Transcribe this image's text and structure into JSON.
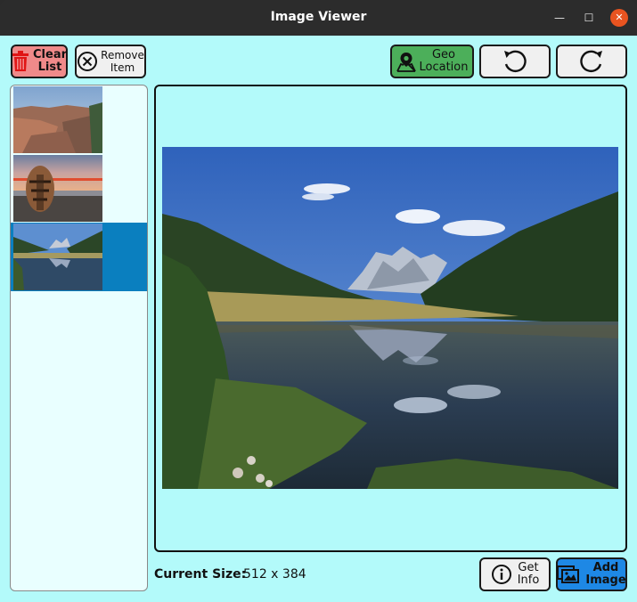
{
  "window": {
    "title": "Image Viewer",
    "minimize_glyph": "—",
    "maximize_glyph": "☐",
    "close_glyph": "✕"
  },
  "toolbar": {
    "clear_label_1": "Clear",
    "clear_label_2": "List",
    "remove_label_1": "Remove",
    "remove_label_2": "Item",
    "geo_label_1": "Geo",
    "geo_label_2": "Location",
    "icons": [
      "trash-icon",
      "circle-x-icon",
      "map-pin-icon",
      "rotate-left-icon",
      "rotate-right-icon"
    ]
  },
  "sidebar": {
    "items": [
      {
        "name": "canyon",
        "selected": false
      },
      {
        "name": "beach-sunset-carving",
        "selected": false
      },
      {
        "name": "mountain-lake",
        "selected": true
      }
    ]
  },
  "status": {
    "size_label": "Current Size:",
    "size_value": "512 x 384"
  },
  "bottom_buttons": {
    "info_label_1": "Get",
    "info_label_2": "Info",
    "add_label_1": "Add",
    "add_label_2": "Image",
    "icons": [
      "info-icon",
      "images-icon"
    ]
  },
  "colors": {
    "background": "#b3fafa",
    "clear_button": "#f08a8a",
    "geo_button": "#4caf5a",
    "add_button": "#1e88e5",
    "selected_row": "#0a7fbf",
    "close_button": "#e95420"
  }
}
